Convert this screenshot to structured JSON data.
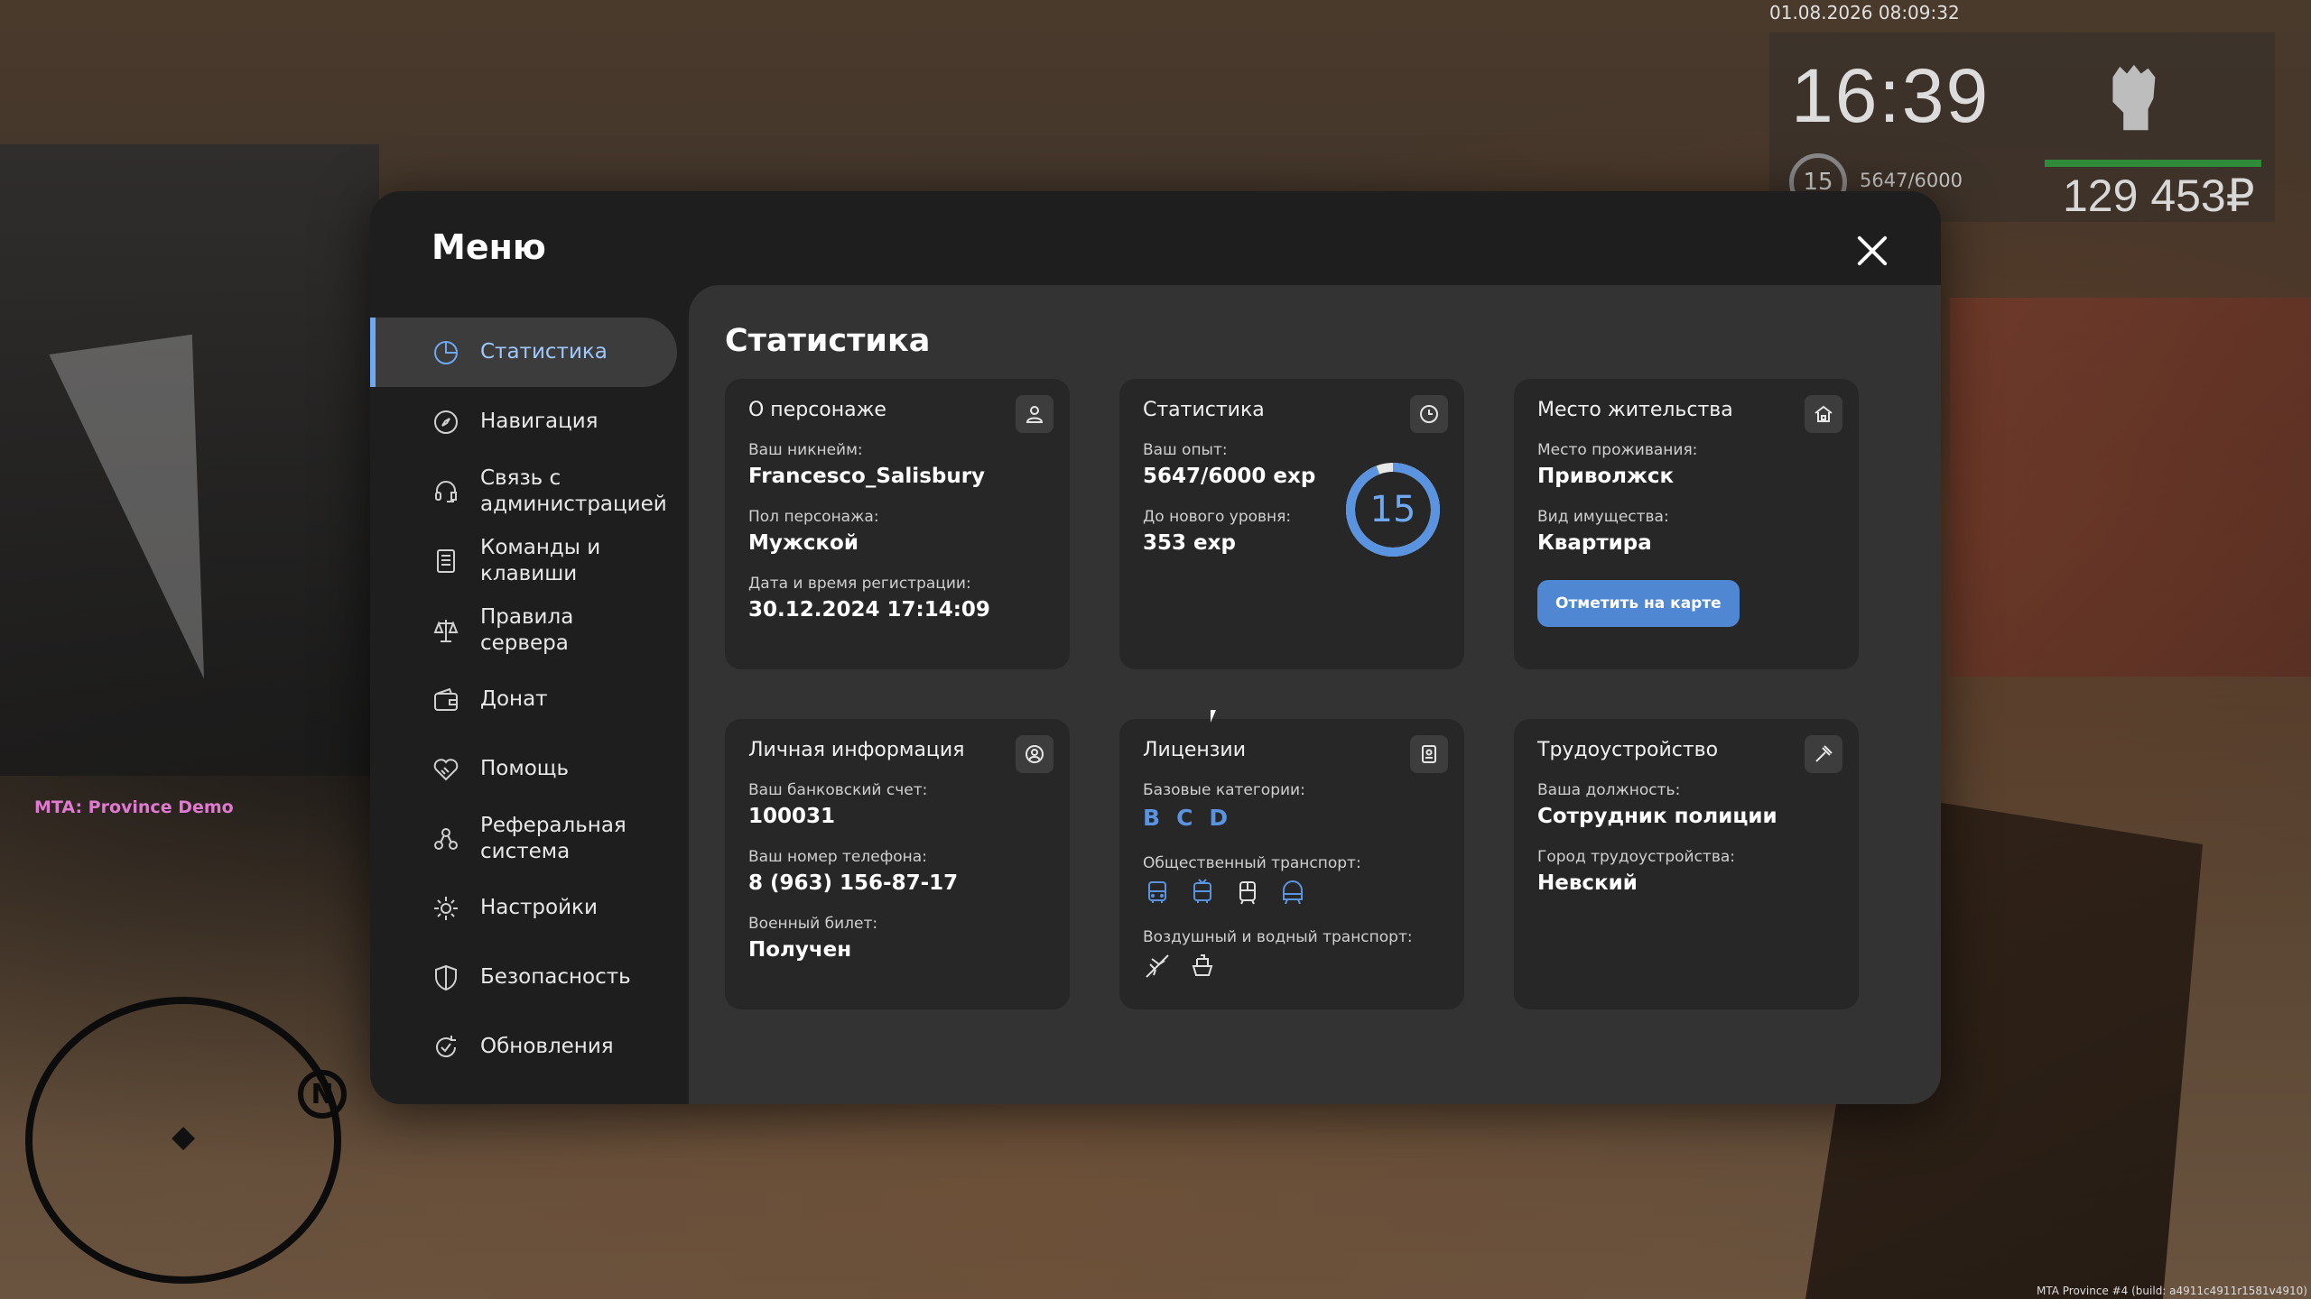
{
  "hud": {
    "datetime": "01.08.2026 08:09:32",
    "time": "16:39",
    "level": "15",
    "exp": "5647/6000",
    "money": "129 453₽",
    "health_fraction": 1.0,
    "server_label": "MTA: Province Demo",
    "radar_north": "N",
    "build": "MTA Province #4 (build: a4911c4911r1581v4910)"
  },
  "menu": {
    "title": "Меню",
    "nav": [
      {
        "label": "Статистика",
        "icon": "pie-chart-icon",
        "active": true
      },
      {
        "label": "Навигация",
        "icon": "compass-icon"
      },
      {
        "label": "Связь с администрацией",
        "icon": "headset-icon"
      },
      {
        "label": "Команды и клавиши",
        "icon": "list-icon"
      },
      {
        "label": "Правила сервера",
        "icon": "scales-icon"
      },
      {
        "label": "Донат",
        "icon": "wallet-icon"
      },
      {
        "label": "Помощь",
        "icon": "handshake-icon"
      },
      {
        "label": "Реферальная система",
        "icon": "referral-icon"
      },
      {
        "label": "Настройки",
        "icon": "gear-icon"
      },
      {
        "label": "Безопасность",
        "icon": "shield-icon"
      },
      {
        "label": "Обновления",
        "icon": "refresh-icon"
      }
    ]
  },
  "content": {
    "title": "Статистика",
    "character": {
      "title": "О персонаже",
      "nickname_label": "Ваш никнейм:",
      "nickname": "Francesco_Salisbury",
      "gender_label": "Пол персонажа:",
      "gender": "Мужской",
      "reg_label": "Дата и время регистрации:",
      "reg": "30.12.2024 17:14:09"
    },
    "stats": {
      "title": "Статистика",
      "exp_label": "Ваш опыт:",
      "exp": "5647/6000 exp",
      "next_label": "До нового уровня:",
      "next": "353 exp",
      "level": "15",
      "progress": 0.941
    },
    "residence": {
      "title": "Место жительства",
      "place_label": "Место проживания:",
      "place": "Приволжск",
      "type_label": "Вид имущества:",
      "type": "Квартира",
      "button": "Отметить на карте"
    },
    "personal": {
      "title": "Личная информация",
      "bank_label": "Ваш банковский счет:",
      "bank": "100031",
      "phone_label": "Ваш номер телефона:",
      "phone": "8 (963) 156-87-17",
      "military_label": "Военный билет:",
      "military": "Получен"
    },
    "licenses": {
      "title": "Лицензии",
      "base_label": "Базовые категории:",
      "categories": [
        "B",
        "C",
        "D"
      ],
      "public_label": "Общественный транспорт:",
      "public_icons": [
        "bus-icon",
        "trolleybus-icon",
        "tram-icon",
        "metro-icon"
      ],
      "air_label": "Воздушный и водный транспорт:",
      "air_icons": [
        "plane-icon",
        "boat-icon"
      ]
    },
    "job": {
      "title": "Трудоустройство",
      "position_label": "Ваша должность:",
      "position": "Сотрудник полиции",
      "city_label": "Город трудоустройства:",
      "city": "Невский"
    }
  },
  "colors": {
    "accent": "#6ea8f0",
    "button": "#4f87d3",
    "card": "#272727",
    "panel": "#333333",
    "sidebar": "#1e1e1e",
    "server_label": "#e07ad0",
    "health": "#2f8a3a"
  }
}
